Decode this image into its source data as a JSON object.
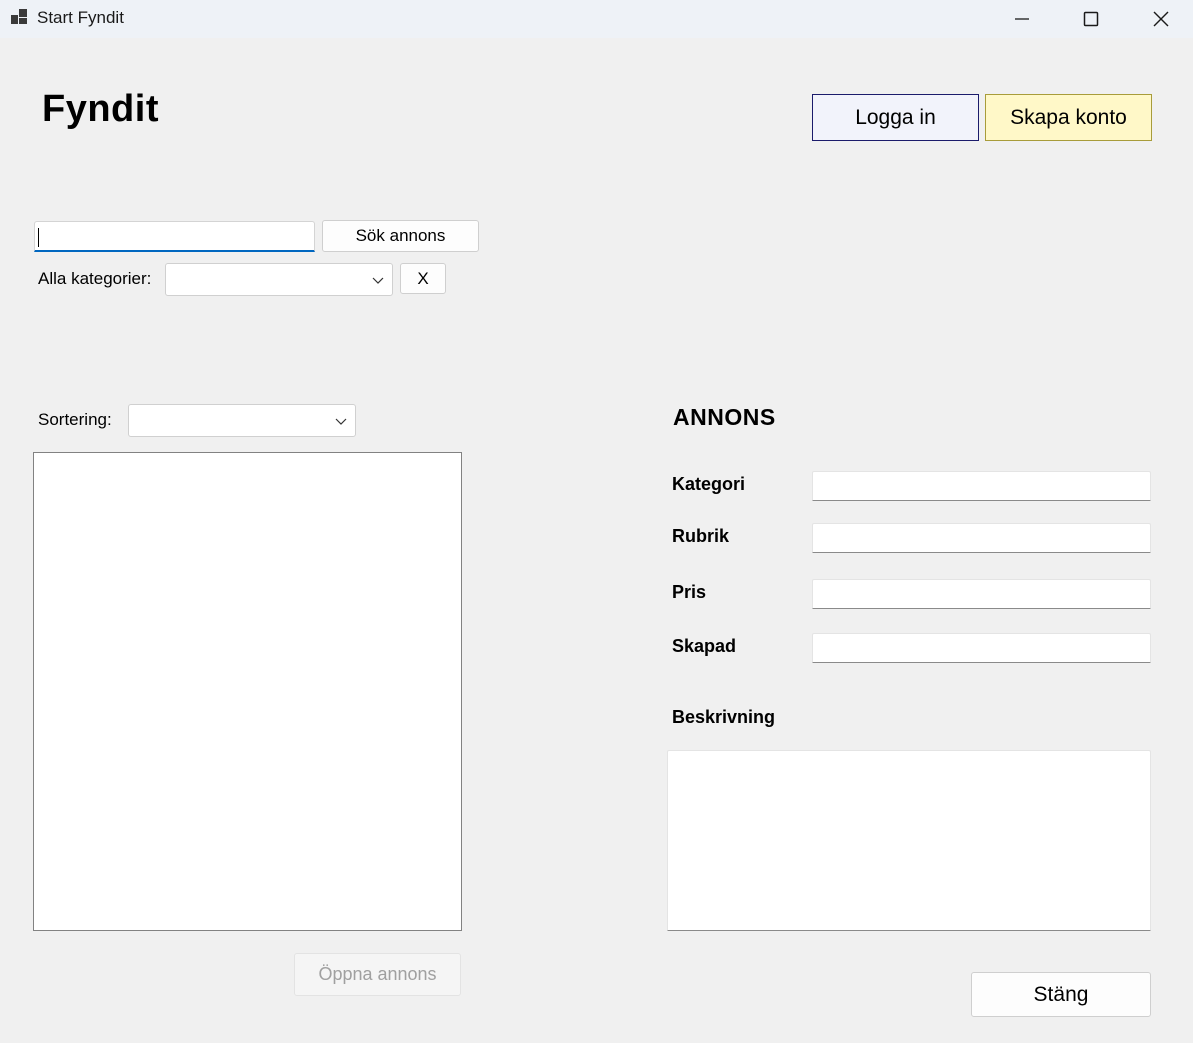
{
  "window": {
    "title": "Start Fyndit",
    "icon": "app-window-icon",
    "controls": {
      "minimize_icon": "minimize-icon",
      "maximize_icon": "maximize-icon",
      "close_icon": "close-icon"
    }
  },
  "header": {
    "app_name": "Fyndit",
    "login_label": "Logga in",
    "create_account_label": "Skapa konto"
  },
  "search": {
    "value": "",
    "button_label": "Sök annons",
    "categories_label": "Alla kategorier:",
    "categories_selected": "",
    "clear_label": "X"
  },
  "listing": {
    "sort_label": "Sortering:",
    "sort_selected": "",
    "items": [],
    "open_label": "Öppna annons"
  },
  "ad": {
    "heading": "ANNONS",
    "category_label": "Kategori",
    "category_value": "",
    "title_label": "Rubrik",
    "title_value": "",
    "price_label": "Pris",
    "price_value": "",
    "created_label": "Skapad",
    "created_value": "",
    "description_label": "Beskrivning",
    "description_value": "",
    "close_label": "Stäng"
  },
  "colors": {
    "background": "#f0f0f0",
    "titlebar": "#eef2f7",
    "login_button_bg": "#f2f3fb",
    "login_button_border": "#1b1b6b",
    "create_button_bg": "#fff8c8",
    "focus_accent": "#0067c0"
  }
}
